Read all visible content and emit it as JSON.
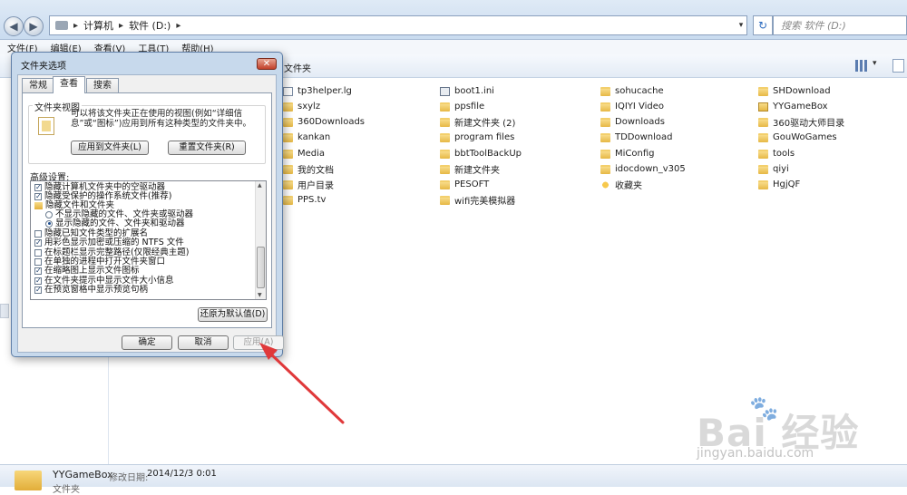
{
  "explorer": {
    "address_crumbs": [
      "计算机",
      "软件 (D:)"
    ],
    "search_placeholder": "搜索 软件 (D:)",
    "menu": [
      "文件(F)",
      "编辑(E)",
      "查看(V)",
      "工具(T)",
      "帮助(H)"
    ],
    "toolbar_crumb": "文件夹"
  },
  "files": [
    {
      "name": "tp3helper.lg",
      "type": "doc"
    },
    {
      "name": "sxylz",
      "type": "folder"
    },
    {
      "name": "360Downloads",
      "type": "folder"
    },
    {
      "name": "kankan",
      "type": "folder"
    },
    {
      "name": "Media",
      "type": "folder"
    },
    {
      "name": "我的文档",
      "type": "folder"
    },
    {
      "name": "用户目录",
      "type": "folder"
    },
    {
      "name": "PPS.tv",
      "type": "folder"
    },
    {
      "name": "boot1.ini",
      "type": "sys"
    },
    {
      "name": "ppsfile",
      "type": "folder"
    },
    {
      "name": "新建文件夹 (2)",
      "type": "folder"
    },
    {
      "name": "program files",
      "type": "folder"
    },
    {
      "name": "bbtToolBackUp",
      "type": "folder"
    },
    {
      "name": "新建文件夹",
      "type": "folder"
    },
    {
      "name": "PESOFT",
      "type": "folder"
    },
    {
      "name": "wifi完美模拟器",
      "type": "folder"
    },
    {
      "name": "sohucache",
      "type": "folder"
    },
    {
      "name": "IQIYI Video",
      "type": "folder"
    },
    {
      "name": "Downloads",
      "type": "folder"
    },
    {
      "name": "TDDownload",
      "type": "folder"
    },
    {
      "name": "MiConfig",
      "type": "folder"
    },
    {
      "name": "idocdown_v305",
      "type": "folder"
    },
    {
      "name": "收藏夹",
      "type": "star"
    },
    {
      "name": "SHDownload",
      "type": "folder"
    },
    {
      "name": "YYGameBox",
      "type": "lnk"
    },
    {
      "name": "360驱动大师目录",
      "type": "folder"
    },
    {
      "name": "GouWoGames",
      "type": "folder"
    },
    {
      "name": "tools",
      "type": "folder"
    },
    {
      "name": "qiyi",
      "type": "folder"
    },
    {
      "name": "HgjQF",
      "type": "folder"
    }
  ],
  "status": {
    "name": "YYGameBox",
    "modified_label": "修改日期:",
    "modified_value": "2014/12/3 0:01",
    "type": "文件夹"
  },
  "dialog": {
    "title": "文件夹选项",
    "close": "✕",
    "tabs": [
      "常规",
      "查看",
      "搜索"
    ],
    "active_tab": "查看",
    "group_label": "文件夹视图",
    "group_desc": "可以将该文件夹正在使用的视图(例如“详细信息”或“图标”)应用到所有这种类型的文件夹中。",
    "apply_to_folders": "应用到文件夹(L)",
    "reset_folders": "重置文件夹(R)",
    "advanced_label": "高级设置:",
    "advanced_items": [
      {
        "kind": "checkbox",
        "checked": true,
        "label": "隐藏计算机文件夹中的空驱动器"
      },
      {
        "kind": "checkbox",
        "checked": true,
        "label": "隐藏受保护的操作系统文件(推荐)"
      },
      {
        "kind": "folder",
        "checked": false,
        "label": "隐藏文件和文件夹"
      },
      {
        "kind": "radio",
        "checked": false,
        "label": "不显示隐藏的文件、文件夹或驱动器"
      },
      {
        "kind": "radio",
        "checked": true,
        "label": "显示隐藏的文件、文件夹和驱动器"
      },
      {
        "kind": "checkbox",
        "checked": false,
        "label": "隐藏已知文件类型的扩展名"
      },
      {
        "kind": "checkbox",
        "checked": true,
        "label": "用彩色显示加密或压缩的 NTFS 文件"
      },
      {
        "kind": "checkbox",
        "checked": false,
        "label": "在标题栏显示完整路径(仅限经典主题)"
      },
      {
        "kind": "checkbox",
        "checked": false,
        "label": "在单独的进程中打开文件夹窗口"
      },
      {
        "kind": "checkbox",
        "checked": true,
        "label": "在缩略图上显示文件图标"
      },
      {
        "kind": "checkbox",
        "checked": true,
        "label": "在文件夹提示中显示文件大小信息"
      },
      {
        "kind": "checkbox",
        "checked": true,
        "label": "在预览窗格中显示预览句柄"
      }
    ],
    "restore_defaults": "还原为默认值(D)",
    "ok": "确定",
    "cancel": "取消",
    "apply": "应用(A)"
  },
  "watermark": {
    "brand": "Bai 经验",
    "url": "jingyan.baidu.com"
  },
  "annotation_color": "#e0393b"
}
